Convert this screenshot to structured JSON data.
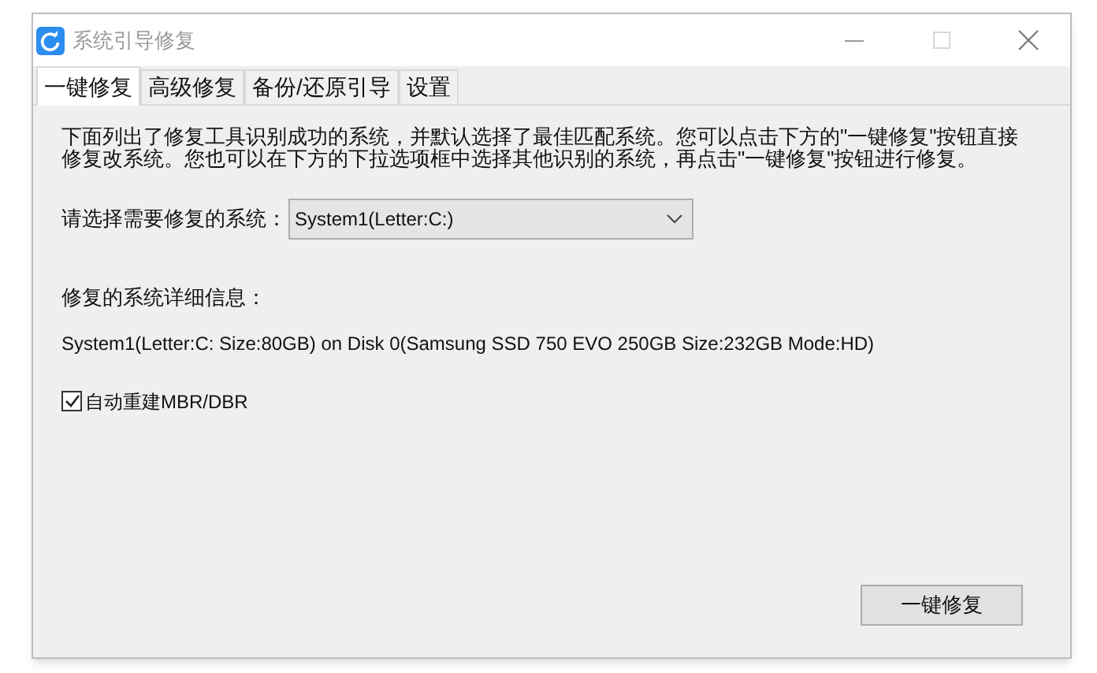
{
  "window": {
    "title": "系统引导修复"
  },
  "tabs": [
    {
      "label": "一键修复",
      "selected": true
    },
    {
      "label": "高级修复",
      "selected": false
    },
    {
      "label": "备份/还原引导",
      "selected": false
    },
    {
      "label": "设置",
      "selected": false
    }
  ],
  "description": "下面列出了修复工具识别成功的系统，并默认选择了最佳匹配系统。您可以点击下方的\"一键修复\"按钮直接修复改系统。您也可以在下方的下拉选项框中选择其他识别的系统，再点击\"一键修复\"按钮进行修复。",
  "system_select": {
    "label": "请选择需要修复的系统：",
    "value": "System1(Letter:C:)"
  },
  "details": {
    "label": "修复的系统详细信息：",
    "text": "System1(Letter:C: Size:80GB) on Disk 0(Samsung SSD 750 EVO 250GB Size:232GB Mode:HD)"
  },
  "checkbox": {
    "label": "自动重建MBR/DBR",
    "checked": true
  },
  "button": {
    "label": "一键修复"
  }
}
